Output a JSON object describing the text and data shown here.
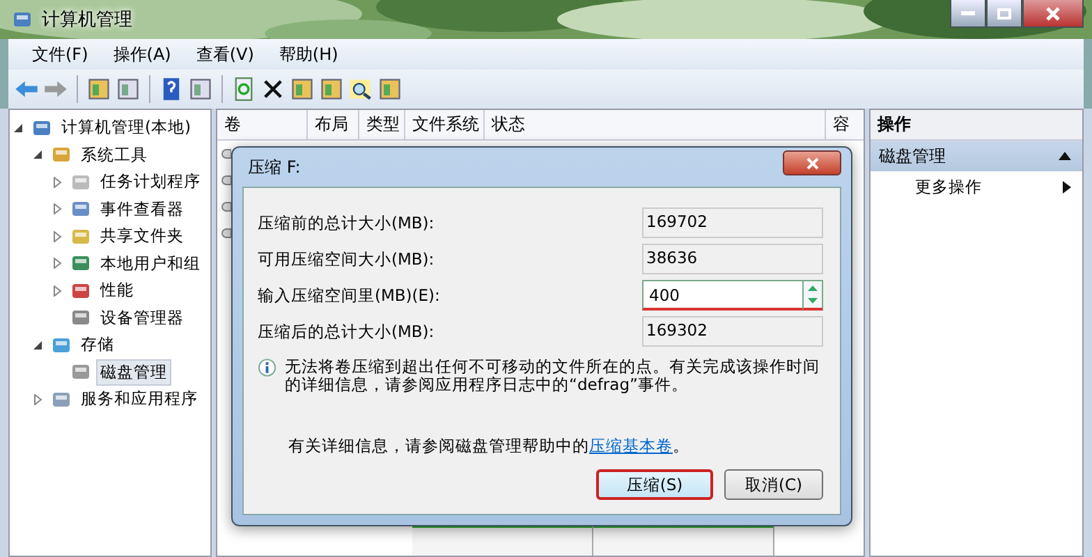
{
  "window": {
    "title": "计算机管理"
  },
  "menu": [
    "文件(F)",
    "操作(A)",
    "查看(V)",
    "帮助(H)"
  ],
  "tree": [
    {
      "label": "计算机管理(本地)",
      "expanded": true,
      "selected": false,
      "children": [
        {
          "label": "系统工具",
          "expanded": true,
          "selected": false,
          "children": [
            {
              "label": "任务计划程序",
              "expanded": false,
              "selected": false
            },
            {
              "label": "事件查看器",
              "expanded": false,
              "selected": false
            },
            {
              "label": "共享文件夹",
              "expanded": false,
              "selected": false
            },
            {
              "label": "本地用户和组",
              "expanded": false,
              "selected": false
            },
            {
              "label": "性能",
              "expanded": false,
              "selected": false
            },
            {
              "label": "设备管理器",
              "selected": false
            }
          ]
        },
        {
          "label": "存储",
          "expanded": true,
          "selected": false,
          "children": [
            {
              "label": "磁盘管理",
              "selected": true
            }
          ]
        },
        {
          "label": "服务和应用程序",
          "expanded": false,
          "selected": false
        }
      ]
    }
  ],
  "table": {
    "columns": [
      "卷",
      "布局",
      "类型",
      "文件系统",
      "状态",
      "容"
    ]
  },
  "actions": {
    "header": "操作",
    "section": {
      "label": "磁盘管理",
      "expanded": true
    },
    "items": [
      "更多操作"
    ]
  },
  "dialog": {
    "title": "压缩 F:",
    "fields": [
      {
        "label": "压缩前的总计大小(MB):",
        "value": "169702",
        "kind": "readonly"
      },
      {
        "label": "可用压缩空间大小(MB):",
        "value": "38636",
        "kind": "readonly"
      },
      {
        "label": "输入压缩空间里(MB)(E):",
        "value": "400",
        "kind": "spin"
      },
      {
        "label": "压缩后的总计大小(MB):",
        "value": "169302",
        "kind": "readonly"
      }
    ],
    "info": "无法将卷压缩到超出任何不可移动的文件所在的点。有关完成该操作时间的详细信息，请参阅应用程序日志中的“defrag”事件。",
    "help_text": "有关详细信息，请参阅磁盘管理帮助中的",
    "help_link": "压缩基本卷",
    "help_end": "。",
    "buttons": [
      {
        "label": "压缩(S)",
        "default": true
      },
      {
        "label": "取消(C)",
        "default": false
      }
    ]
  }
}
